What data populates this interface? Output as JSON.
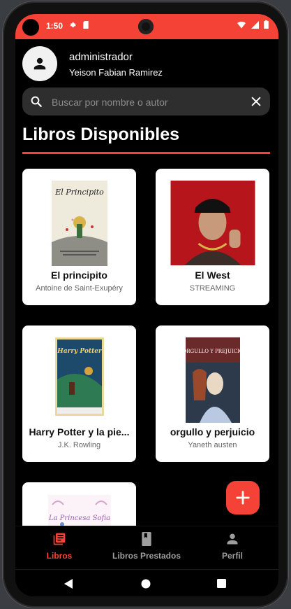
{
  "status_bar": {
    "time": "1:50",
    "background": "#f44336"
  },
  "header": {
    "role": "administrador",
    "user_name": "Yeison Fabian Ramirez",
    "avatar_icon": "person-icon"
  },
  "search": {
    "placeholder": "Buscar por nombre o autor",
    "value": "",
    "icon": "search-icon",
    "clear_icon": "close-icon"
  },
  "page_title": "Libros Disponibles",
  "books": [
    {
      "title": "El principito",
      "author": "Antoine de Saint-Exupéry",
      "cover_text": "El Principito"
    },
    {
      "title": "El West",
      "author": "STREAMING",
      "cover_text": ""
    },
    {
      "title": "Harry Potter y la pie...",
      "author": "J.K. Rowling",
      "cover_text": "Harry Potter"
    },
    {
      "title": "orgullo y perjuicio",
      "author": "Yaneth austen",
      "cover_text": "ORGULLO Y PREJUICIO"
    },
    {
      "title": "",
      "author": "",
      "cover_text": "La Princesa Sofia"
    }
  ],
  "fab": {
    "icon": "plus-icon"
  },
  "bottom_nav": {
    "items": [
      {
        "label": "Libros",
        "icon": "books-icon",
        "active": true
      },
      {
        "label": "Libros Prestados",
        "icon": "book-icon",
        "active": false
      },
      {
        "label": "Perfil",
        "icon": "person-icon",
        "active": false
      }
    ]
  },
  "colors": {
    "accent": "#f44336",
    "background": "#000000",
    "card": "#ffffff"
  }
}
